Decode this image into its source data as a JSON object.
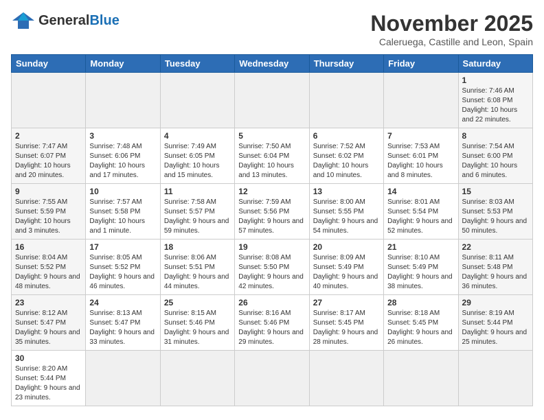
{
  "header": {
    "logo_general": "General",
    "logo_blue": "Blue",
    "month_title": "November 2025",
    "subtitle": "Caleruega, Castille and Leon, Spain"
  },
  "days_of_week": [
    "Sunday",
    "Monday",
    "Tuesday",
    "Wednesday",
    "Thursday",
    "Friday",
    "Saturday"
  ],
  "weeks": [
    [
      {
        "day": "",
        "info": "",
        "empty": true
      },
      {
        "day": "",
        "info": "",
        "empty": true
      },
      {
        "day": "",
        "info": "",
        "empty": true
      },
      {
        "day": "",
        "info": "",
        "empty": true
      },
      {
        "day": "",
        "info": "",
        "empty": true
      },
      {
        "day": "",
        "info": "",
        "empty": true
      },
      {
        "day": "1",
        "info": "Sunrise: 7:46 AM\nSunset: 6:08 PM\nDaylight: 10 hours and 22 minutes."
      }
    ],
    [
      {
        "day": "2",
        "info": "Sunrise: 7:47 AM\nSunset: 6:07 PM\nDaylight: 10 hours and 20 minutes."
      },
      {
        "day": "3",
        "info": "Sunrise: 7:48 AM\nSunset: 6:06 PM\nDaylight: 10 hours and 17 minutes."
      },
      {
        "day": "4",
        "info": "Sunrise: 7:49 AM\nSunset: 6:05 PM\nDaylight: 10 hours and 15 minutes."
      },
      {
        "day": "5",
        "info": "Sunrise: 7:50 AM\nSunset: 6:04 PM\nDaylight: 10 hours and 13 minutes."
      },
      {
        "day": "6",
        "info": "Sunrise: 7:52 AM\nSunset: 6:02 PM\nDaylight: 10 hours and 10 minutes."
      },
      {
        "day": "7",
        "info": "Sunrise: 7:53 AM\nSunset: 6:01 PM\nDaylight: 10 hours and 8 minutes."
      },
      {
        "day": "8",
        "info": "Sunrise: 7:54 AM\nSunset: 6:00 PM\nDaylight: 10 hours and 6 minutes."
      }
    ],
    [
      {
        "day": "9",
        "info": "Sunrise: 7:55 AM\nSunset: 5:59 PM\nDaylight: 10 hours and 3 minutes."
      },
      {
        "day": "10",
        "info": "Sunrise: 7:57 AM\nSunset: 5:58 PM\nDaylight: 10 hours and 1 minute."
      },
      {
        "day": "11",
        "info": "Sunrise: 7:58 AM\nSunset: 5:57 PM\nDaylight: 9 hours and 59 minutes."
      },
      {
        "day": "12",
        "info": "Sunrise: 7:59 AM\nSunset: 5:56 PM\nDaylight: 9 hours and 57 minutes."
      },
      {
        "day": "13",
        "info": "Sunrise: 8:00 AM\nSunset: 5:55 PM\nDaylight: 9 hours and 54 minutes."
      },
      {
        "day": "14",
        "info": "Sunrise: 8:01 AM\nSunset: 5:54 PM\nDaylight: 9 hours and 52 minutes."
      },
      {
        "day": "15",
        "info": "Sunrise: 8:03 AM\nSunset: 5:53 PM\nDaylight: 9 hours and 50 minutes."
      }
    ],
    [
      {
        "day": "16",
        "info": "Sunrise: 8:04 AM\nSunset: 5:52 PM\nDaylight: 9 hours and 48 minutes."
      },
      {
        "day": "17",
        "info": "Sunrise: 8:05 AM\nSunset: 5:52 PM\nDaylight: 9 hours and 46 minutes."
      },
      {
        "day": "18",
        "info": "Sunrise: 8:06 AM\nSunset: 5:51 PM\nDaylight: 9 hours and 44 minutes."
      },
      {
        "day": "19",
        "info": "Sunrise: 8:08 AM\nSunset: 5:50 PM\nDaylight: 9 hours and 42 minutes."
      },
      {
        "day": "20",
        "info": "Sunrise: 8:09 AM\nSunset: 5:49 PM\nDaylight: 9 hours and 40 minutes."
      },
      {
        "day": "21",
        "info": "Sunrise: 8:10 AM\nSunset: 5:49 PM\nDaylight: 9 hours and 38 minutes."
      },
      {
        "day": "22",
        "info": "Sunrise: 8:11 AM\nSunset: 5:48 PM\nDaylight: 9 hours and 36 minutes."
      }
    ],
    [
      {
        "day": "23",
        "info": "Sunrise: 8:12 AM\nSunset: 5:47 PM\nDaylight: 9 hours and 35 minutes."
      },
      {
        "day": "24",
        "info": "Sunrise: 8:13 AM\nSunset: 5:47 PM\nDaylight: 9 hours and 33 minutes."
      },
      {
        "day": "25",
        "info": "Sunrise: 8:15 AM\nSunset: 5:46 PM\nDaylight: 9 hours and 31 minutes."
      },
      {
        "day": "26",
        "info": "Sunrise: 8:16 AM\nSunset: 5:46 PM\nDaylight: 9 hours and 29 minutes."
      },
      {
        "day": "27",
        "info": "Sunrise: 8:17 AM\nSunset: 5:45 PM\nDaylight: 9 hours and 28 minutes."
      },
      {
        "day": "28",
        "info": "Sunrise: 8:18 AM\nSunset: 5:45 PM\nDaylight: 9 hours and 26 minutes."
      },
      {
        "day": "29",
        "info": "Sunrise: 8:19 AM\nSunset: 5:44 PM\nDaylight: 9 hours and 25 minutes."
      }
    ],
    [
      {
        "day": "30",
        "info": "Sunrise: 8:20 AM\nSunset: 5:44 PM\nDaylight: 9 hours and 23 minutes.",
        "has_data": true
      },
      {
        "day": "",
        "info": "",
        "empty": true
      },
      {
        "day": "",
        "info": "",
        "empty": true
      },
      {
        "day": "",
        "info": "",
        "empty": true
      },
      {
        "day": "",
        "info": "",
        "empty": true
      },
      {
        "day": "",
        "info": "",
        "empty": true
      },
      {
        "day": "",
        "info": "",
        "empty": true
      }
    ]
  ]
}
